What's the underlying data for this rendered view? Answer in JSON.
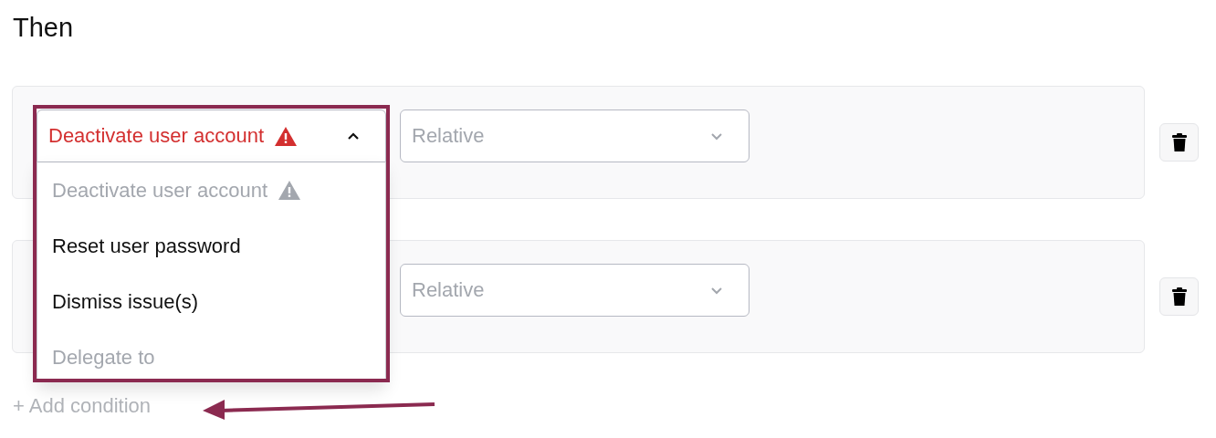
{
  "heading": "Then",
  "actions": [
    {
      "action": {
        "value": "Deactivate user account",
        "warning": true,
        "expanded": true,
        "options": [
          {
            "label": "Deactivate user account",
            "disabled": true,
            "warning": true
          },
          {
            "label": "Reset user password",
            "disabled": false,
            "warning": false
          },
          {
            "label": "Dismiss issue(s)",
            "disabled": false,
            "warning": false
          },
          {
            "label": "Delegate to",
            "disabled": true,
            "warning": false
          }
        ]
      },
      "target": {
        "placeholder": "Relative"
      }
    },
    {
      "target": {
        "placeholder": "Relative"
      }
    }
  ],
  "add_condition": {
    "label": "+ Add condition"
  }
}
